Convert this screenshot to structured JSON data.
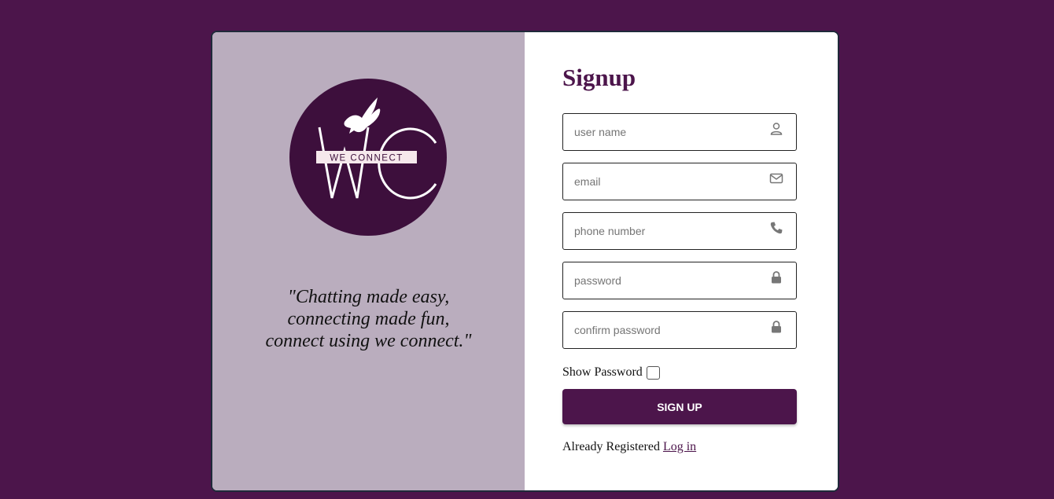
{
  "brand": {
    "logo_text": "WE CONNECT",
    "logo_initials": "WC",
    "tagline": [
      "\"Chatting made easy,",
      "connecting made fun,",
      "connect using we connect.\""
    ]
  },
  "form": {
    "title": "Signup",
    "fields": [
      {
        "placeholder": "user name",
        "value": "",
        "icon": "user-icon"
      },
      {
        "placeholder": "email",
        "value": "",
        "icon": "envelope-icon"
      },
      {
        "placeholder": "phone number",
        "value": "",
        "icon": "phone-icon"
      },
      {
        "placeholder": "password",
        "value": "",
        "icon": "lock-icon"
      },
      {
        "placeholder": "confirm password",
        "value": "",
        "icon": "lock-icon"
      }
    ],
    "show_password_label": "Show Password",
    "show_password_checked": false,
    "submit_label": "SIGN UP",
    "already_text": "Already Registered",
    "login_link": "Log in"
  },
  "colors": {
    "background": "#4c154b",
    "left_panel": "#baadbe",
    "accent": "#4c154b",
    "logo_circle": "#3d0f3c",
    "logo_band": "#f6e8ec"
  }
}
